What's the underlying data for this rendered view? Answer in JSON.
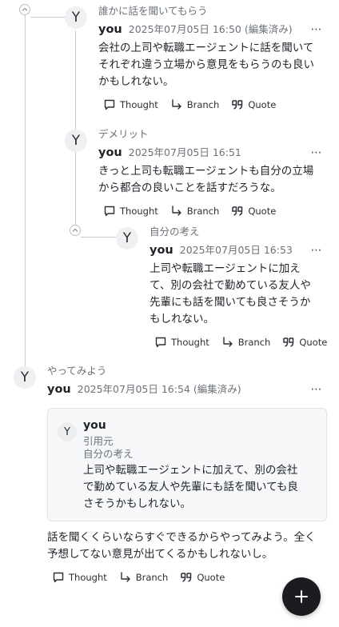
{
  "actions": {
    "thought": "Thought",
    "branch": "Branch",
    "quote": "Quote"
  },
  "posts": [
    {
      "avatar": "Y",
      "subject": "誰かに話を聞いてもらう",
      "author": "you",
      "date": "2025年07月05日 16:50",
      "edited": "(編集済み)",
      "lines": [
        "会社の上司や転職エージェントに話を聞いて",
        "それぞれ違う立場から意見をもらうのも良い",
        "かもしれない。"
      ]
    },
    {
      "avatar": "Y",
      "subject": "デメリット",
      "author": "you",
      "date": "2025年07月05日 16:51",
      "lines": [
        "きっと上司も転職エージェントも自分の立場",
        "から都合の良いことを話すだろうな。"
      ]
    },
    {
      "avatar": "Y",
      "subject": "自分の考え",
      "author": "you",
      "date": "2025年07月05日 16:53",
      "lines": [
        "上司や転職エージェントに加え",
        "て、別の会社で勤めている友人や",
        "先輩にも話を聞いても良さそうか",
        "もしれない。"
      ]
    },
    {
      "avatar": "Y",
      "subject": "やってみよう",
      "author": "you",
      "date": "2025年07月05日 16:54",
      "edited": "(編集済み)",
      "lines": [
        "話を聞くくらいならすぐできるからやってみよう。全く",
        "予想してない意見が出てくるかもしれないし。"
      ]
    }
  ],
  "quote_card": {
    "avatar": "Y",
    "author": "you",
    "source_label": "引用元",
    "subject": "自分の考え",
    "lines": [
      "上司や転職エージェントに加えて、別の会社",
      "で勤めている友人や先輩にも話を聞いても良",
      "さそうかもしれない。"
    ]
  },
  "more_icon": "⋯",
  "fab_icon": "plus-icon"
}
